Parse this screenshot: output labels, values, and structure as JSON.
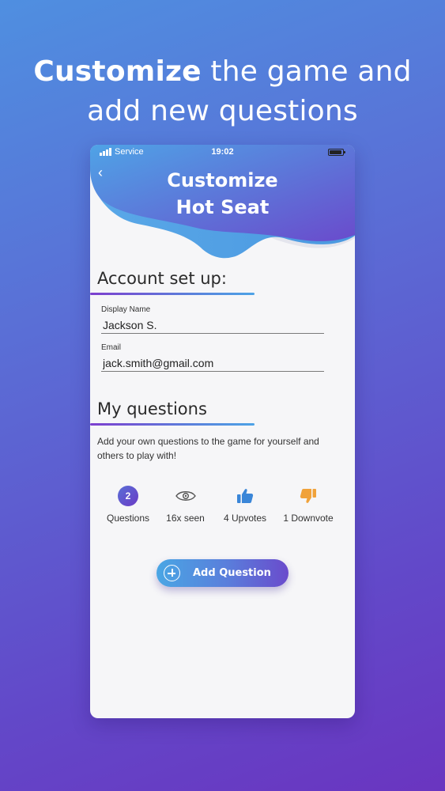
{
  "headline": {
    "bold": "Customize",
    "rest_line1": " the game and",
    "line2": "add new questions"
  },
  "status_bar": {
    "carrier": "Service",
    "time": "19:02"
  },
  "header": {
    "back": "‹",
    "title_line1": "Customize",
    "title_line2": "Hot Seat"
  },
  "account": {
    "title": "Account set up:",
    "display_name": {
      "label": "Display Name",
      "value": "Jackson S."
    },
    "email": {
      "label": "Email",
      "value": "jack.smith@gmail.com"
    }
  },
  "questions": {
    "title": "My questions",
    "description": "Add your own questions to the game for yourself and others to play with!",
    "stats": {
      "count": "2",
      "count_label": "Questions",
      "seen_label": "16x seen",
      "upvotes_label": "4 Upvotes",
      "downvotes_label": "1 Downvote"
    },
    "add_button": "Add Question"
  },
  "colors": {
    "accent_purple": "#6a3bc6",
    "accent_blue": "#4aa6e4",
    "upvote": "#3a86d8",
    "downvote": "#f0a23a"
  },
  "icons": [
    "eye-icon",
    "thumbs-up-icon",
    "thumbs-down-icon",
    "plus-circle-icon",
    "back-chevron-icon"
  ]
}
